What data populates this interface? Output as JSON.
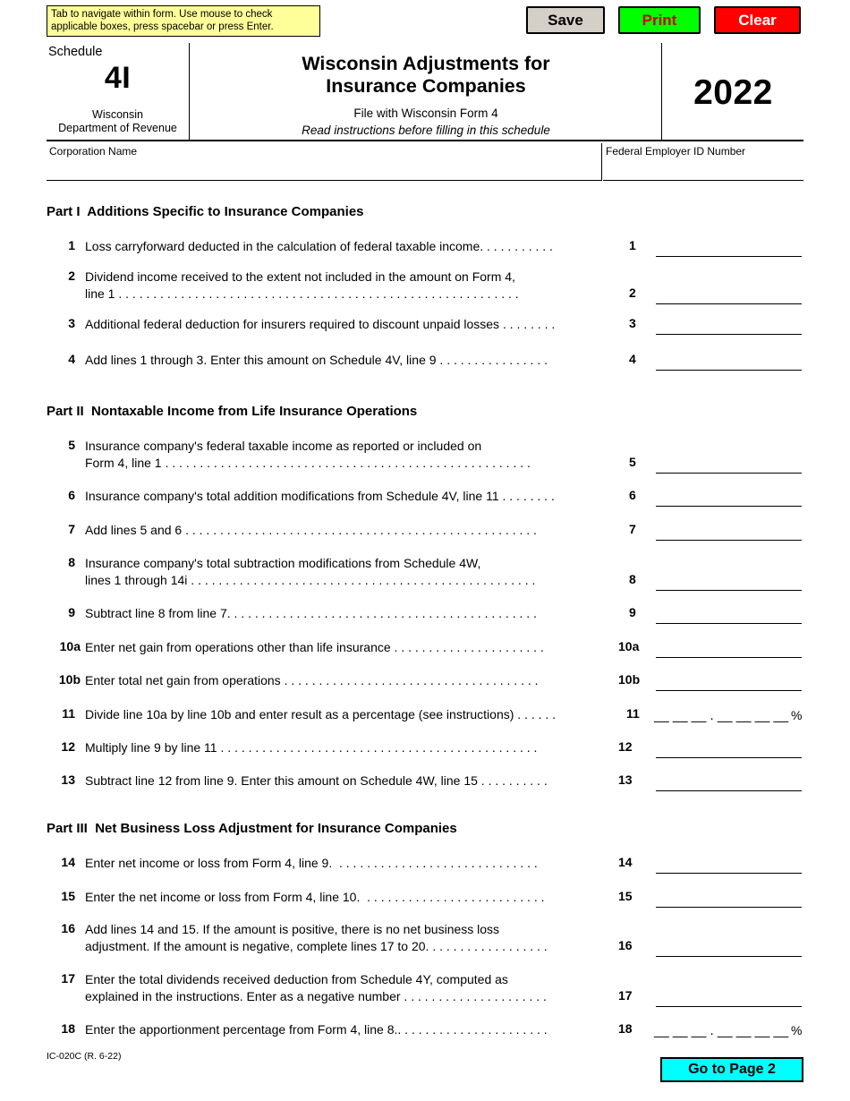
{
  "toolbar": {
    "tab_hint": "Tab to navigate within form. Use mouse to check applicable boxes, press spacebar or press Enter.",
    "save_label": "Save",
    "print_label": "Print",
    "clear_label": "Clear"
  },
  "header": {
    "schedule_word": "Schedule",
    "schedule_number": "4I",
    "agency_line1": "Wisconsin",
    "agency_line2": "Department of Revenue",
    "title_line1": "Wisconsin Adjustments for",
    "title_line2": "Insurance Companies",
    "subtitle1": "File with Wisconsin Form 4",
    "subtitle2": "Read instructions before filling in this schedule",
    "year": "2022"
  },
  "identity": {
    "corporation_name_label": "Corporation Name",
    "corporation_name_value": "",
    "fein_label": "Federal Employer ID Number",
    "fein_value": ""
  },
  "parts": [
    {
      "label": "Part I",
      "title": "Additions Specific to Insurance Companies"
    },
    {
      "label": "Part II",
      "title": "Nontaxable Income from Life Insurance Operations"
    },
    {
      "label": "Part III",
      "title": "Net Business Loss Adjustment for Insurance Companies"
    }
  ],
  "lines": [
    {
      "number": "1",
      "text": "Loss carryforward deducted in the calculation of federal taxable income. . . . . . . . . . .",
      "right_number": "1",
      "value": ""
    },
    {
      "number": "2",
      "text": "Dividend income received to the extent not included in the amount on Form 4,\nline 1 . . . . . . . . . . . . . . . . . . . . . . . . . . . . . . . . . . . . . . . . . . . . . . . . . . . . . . . . . .",
      "right_number": "2",
      "value": ""
    },
    {
      "number": "3",
      "text": "Additional federal deduction for insurers required to discount unpaid losses . . . . . . . .",
      "right_number": "3",
      "value": ""
    },
    {
      "number": "4",
      "text": "Add lines 1 through 3. Enter this amount on Schedule 4V, line 9 . . . . . . . . . . . . . . . .",
      "right_number": "4",
      "value": ""
    },
    {
      "number": "5",
      "text": "Insurance company's federal taxable income as reported or included on\nForm 4, line 1 . . . . . . . . . . . . . . . . . . . . . . . . . . . . . . . . . . . . . . . . . . . . . . . . . . . . .",
      "right_number": "5",
      "value": ""
    },
    {
      "number": "6",
      "text": "Insurance company's total addition modifications from Schedule 4V, line 11 . . . . . . . .",
      "right_number": "6",
      "value": ""
    },
    {
      "number": "7",
      "text": "Add lines 5 and 6 . . . . . . . . . . . . . . . . . . . . . . . . . . . . . . . . . . . . . . . . . . . . . . . . . . .",
      "right_number": "7",
      "value": ""
    },
    {
      "number": "8",
      "text": "Insurance company's total subtraction modifications from Schedule 4W,\nlines 1 through 14i . . . . . . . . . . . . . . . . . . . . . . . . . . . . . . . . . . . . . . . . . . . . . . . . . .",
      "right_number": "8",
      "value": ""
    },
    {
      "number": "9",
      "text": "Subtract line 8 from line 7. . . . . . . . . . . . . . . . . . . . . . . . . . . . . . . . . . . . . . . . . . . . .",
      "right_number": "9",
      "value": ""
    },
    {
      "number": "10a",
      "text": "Enter net gain from operations other than life insurance . . . . . . . . . . . . . . . . . . . . . .",
      "right_number": "10a",
      "value": ""
    },
    {
      "number": "10b",
      "text": "Enter total net gain from operations . . . . . . . . . . . . . . . . . . . . . . . . . . . . . . . . . . . . .",
      "right_number": "10b",
      "value": ""
    },
    {
      "number": "11",
      "text": "Divide line 10a by line 10b and enter result as a percentage (see instructions) . . . . . .",
      "right_number": "11",
      "value": "__ __ __ . __ __ __ __",
      "percent": true,
      "percent_sign": "%"
    },
    {
      "number": "12",
      "text": "Multiply line 9 by line 11 . . . . . . . . . . . . . . . . . . . . . . . . . . . . . . . . . . . . . . . . . . . . . .",
      "right_number": "12",
      "value": ""
    },
    {
      "number": "13",
      "text": "Subtract line 12 from line 9. Enter this amount on Schedule 4W, line 15 . . . . . . . . . .",
      "right_number": "13",
      "value": ""
    },
    {
      "number": "14",
      "text": "Enter net income or loss from Form 4, line 9.  . . . . . . . . . . . . . . . . . . . . . . . . . . . . .",
      "right_number": "14",
      "value": ""
    },
    {
      "number": "15",
      "text": "Enter the net income or loss from Form 4, line 10.  . . . . . . . . . . . . . . . . . . . . . . . . . .",
      "right_number": "15",
      "value": ""
    },
    {
      "number": "16",
      "text": "Add lines 14 and 15. If the amount is positive, there is no net business loss\nadjustment. If the amount is negative, complete lines 17 to 20. . . . . . . . . . . . . . . . . .",
      "right_number": "16",
      "value": ""
    },
    {
      "number": "17",
      "text": "Enter the total dividends received deduction from Schedule 4Y, computed as\nexplained in the instructions. Enter as a negative number . . . . . . . . . . . . . . . . . . . . .",
      "right_number": "17",
      "value": ""
    },
    {
      "number": "18",
      "text": "Enter the apportionment percentage from Form 4, line 8.. . . . . . . . . . . . . . . . . . . . . .",
      "right_number": "18",
      "value": "__ __ __ . __ __ __ __",
      "percent": true,
      "percent_sign": "%"
    }
  ],
  "footer": {
    "form_id": "IC-020C (R. 6-22)",
    "next_page_label": "Go to Page 2"
  }
}
